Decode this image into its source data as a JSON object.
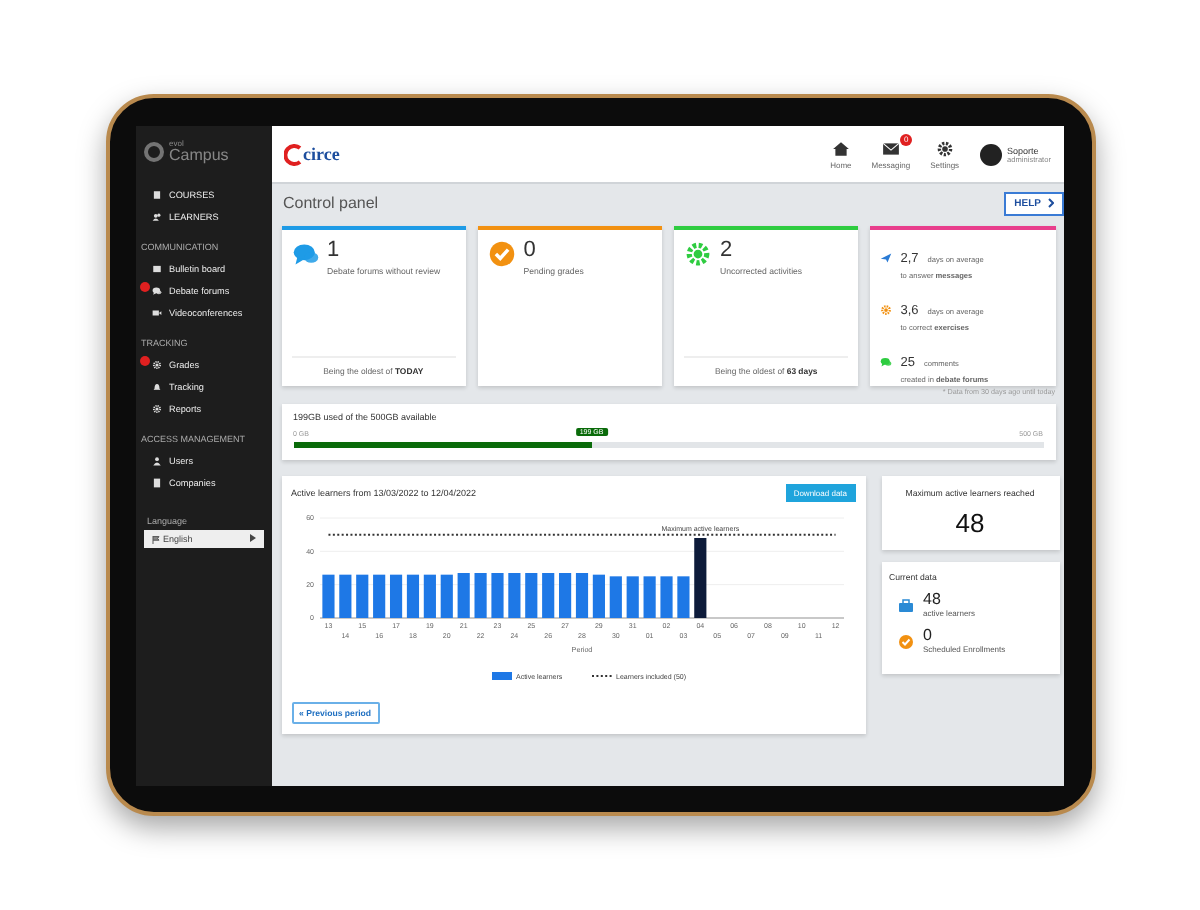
{
  "sidebar": {
    "logo_small": "evol",
    "logo": "Campus",
    "groups": [
      {
        "items": [
          {
            "label": "COURSES",
            "alert": false
          },
          {
            "label": "LEARNERS",
            "alert": false
          }
        ]
      },
      {
        "heading": "COMMUNICATION",
        "items": [
          {
            "label": "Bulletin board",
            "alert": false
          },
          {
            "label": "Debate forums",
            "alert": true
          },
          {
            "label": "Videoconferences",
            "alert": false
          }
        ]
      },
      {
        "heading": "TRACKING",
        "items": [
          {
            "label": "Grades",
            "alert": true
          },
          {
            "label": "Tracking",
            "alert": false
          },
          {
            "label": "Reports",
            "alert": false
          }
        ]
      },
      {
        "heading": "ACCESS MANAGEMENT",
        "items": [
          {
            "label": "Users",
            "alert": false
          },
          {
            "label": "Companies",
            "alert": false
          }
        ]
      }
    ],
    "language_label": "Language",
    "language": "English"
  },
  "topbar": {
    "logo": "circe",
    "nav": [
      {
        "label": "Home"
      },
      {
        "label": "Messaging",
        "badge": "0"
      },
      {
        "label": "Settings"
      }
    ],
    "user": {
      "name": "Soporte",
      "role": "administrator"
    }
  },
  "title": "Control panel",
  "help": "HELP",
  "cards": [
    {
      "kind": "stat",
      "color": "#1e9be6",
      "value": "1",
      "label": "Debate forums without review",
      "footer": "Being the oldest of **TODAY**"
    },
    {
      "kind": "stat",
      "color": "#f29111",
      "value": "0",
      "label": "Pending grades"
    },
    {
      "kind": "stat",
      "color": "#2ecc40",
      "value": "2",
      "label": "Uncorrected activities",
      "footer": "Being the oldest of **63 days**"
    },
    {
      "kind": "list",
      "color": "#e83e8c",
      "items": [
        {
          "value": "2,7",
          "text": "days on average",
          "sub": "to answer **messages**"
        },
        {
          "value": "3,6",
          "text": "days on average",
          "sub": "to correct **exercises**"
        },
        {
          "value": "25",
          "text": "comments",
          "sub": "created in **debate forums**"
        }
      ]
    }
  ],
  "note": "* Data from 30 days ago until today",
  "storage": {
    "title": "199GB used of the 500GB available",
    "min_label": "0 GB",
    "max_label": "500 GB",
    "value_label": "199 GB",
    "level": 0.398
  },
  "activity": {
    "title": "Active learners from 13/03/2022 to 12/04/2022",
    "download": "Download data",
    "previous": "« Previous period",
    "chart_data": {
      "type": "bar",
      "xlabel": "Period",
      "categories": [
        "13",
        "14",
        "15",
        "16",
        "17",
        "18",
        "19",
        "20",
        "21",
        "22",
        "23",
        "24",
        "25",
        "26",
        "27",
        "28",
        "29",
        "30",
        "31",
        "01",
        "02",
        "03",
        "04",
        "05",
        "06",
        "07",
        "08",
        "09",
        "10",
        "11",
        "12"
      ],
      "series": [
        {
          "name": "Active learners",
          "color": "#1e78e6",
          "values": [
            26,
            26,
            26,
            26,
            26,
            26,
            26,
            26,
            27,
            27,
            27,
            27,
            27,
            27,
            27,
            27,
            26,
            25,
            25,
            25,
            25,
            25,
            null,
            null,
            null,
            null,
            null,
            null,
            null,
            null,
            null
          ]
        },
        {
          "color": "#0d1b3a",
          "values": [
            null,
            null,
            null,
            null,
            null,
            null,
            null,
            null,
            null,
            null,
            null,
            null,
            null,
            null,
            null,
            null,
            null,
            null,
            null,
            null,
            null,
            null,
            48,
            null,
            null,
            null,
            null,
            null,
            null,
            null,
            null
          ]
        },
        {
          "name": "Learners included (50)",
          "type": "line",
          "line_style": "dashed",
          "color": "#333333",
          "values": [
            50,
            50,
            50,
            50,
            50,
            50,
            50,
            50,
            50,
            50,
            50,
            50,
            50,
            50,
            50,
            50,
            50,
            50,
            50,
            50,
            50,
            50,
            50,
            50,
            50,
            50,
            50,
            50,
            50,
            50,
            50
          ]
        }
      ],
      "ylim": [
        0,
        60
      ],
      "yticks": [
        0,
        20,
        40,
        60
      ],
      "legend": "bottom",
      "annotations": [
        {
          "x": "04",
          "text": "Maximum active learners"
        }
      ]
    }
  },
  "max_panel": {
    "title": "Maximum active learners reached",
    "value": "48"
  },
  "current": {
    "title": "Current data",
    "items": [
      {
        "value": "48",
        "label": "active learners"
      },
      {
        "value": "0",
        "label": "Scheduled Enrollments"
      }
    ]
  }
}
